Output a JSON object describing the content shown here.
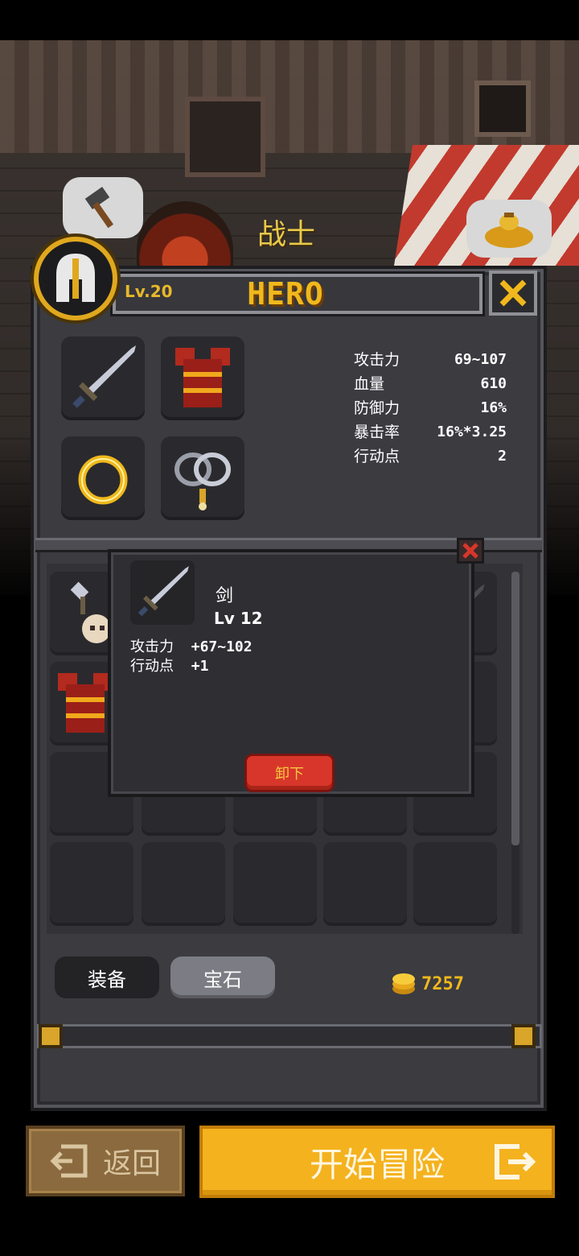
{
  "header": {
    "character_name": "战士",
    "level_label": "Lv.20",
    "title": "HERO"
  },
  "stats": [
    {
      "label": "攻击力",
      "value": "69~107"
    },
    {
      "label": "血量",
      "value": "610"
    },
    {
      "label": "防御力",
      "value": "16%"
    },
    {
      "label": "暴击率",
      "value": "16%*3.25"
    },
    {
      "label": "行动点",
      "value": "2"
    }
  ],
  "equipped_slots": [
    "sword-icon",
    "armor-icon",
    "ring-icon",
    "amulet-icon"
  ],
  "item_popup": {
    "name": "剑",
    "level": "Lv 12",
    "stats": [
      {
        "label": "攻击力",
        "value": "+67~102"
      },
      {
        "label": "行动点",
        "value": "+1"
      }
    ],
    "unequip_label": "卸下"
  },
  "tabs": {
    "equipment": "装备",
    "gems": "宝石"
  },
  "gold": "7257",
  "footer": {
    "back_label": "返回",
    "start_label": "开始冒险"
  },
  "colors": {
    "accent_gold": "#f0b81c",
    "panel": "#3b3b40",
    "danger": "#d8362a",
    "start": "#f4b21e"
  }
}
